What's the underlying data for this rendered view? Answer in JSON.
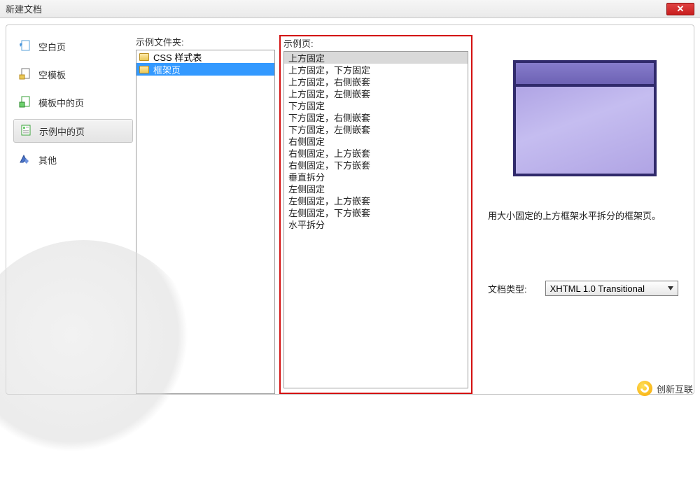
{
  "window": {
    "title": "新建文档"
  },
  "sidebar": {
    "items": [
      {
        "label": "空白页"
      },
      {
        "label": "空模板"
      },
      {
        "label": "模板中的页"
      },
      {
        "label": "示例中的页"
      },
      {
        "label": "其他"
      }
    ]
  },
  "folders": {
    "label": "示例文件夹:",
    "items": [
      {
        "label": "CSS 样式表"
      },
      {
        "label": "框架页"
      }
    ],
    "selectedIndex": 1
  },
  "pages": {
    "label": "示例页:",
    "items": [
      "上方固定",
      "上方固定，下方固定",
      "上方固定，右侧嵌套",
      "上方固定，左侧嵌套",
      "下方固定",
      "下方固定，右侧嵌套",
      "下方固定，左侧嵌套",
      "右侧固定",
      "右侧固定，上方嵌套",
      "右侧固定，下方嵌套",
      "垂直拆分",
      "左侧固定",
      "左侧固定，上方嵌套",
      "左侧固定，下方嵌套",
      "水平拆分"
    ],
    "selectedIndex": 0
  },
  "preview": {
    "description": "用大小固定的上方框架水平拆分的框架页。"
  },
  "docType": {
    "label": "文档类型:",
    "value": "XHTML 1.0 Transitional"
  },
  "watermark": {
    "text": "创新互联"
  }
}
